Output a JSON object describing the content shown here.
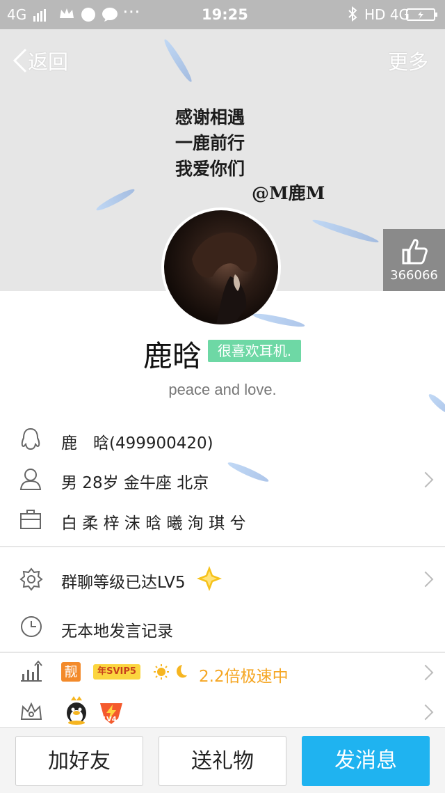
{
  "status_bar": {
    "network": "4G",
    "time": "19:25",
    "right": "HD 4G"
  },
  "nav": {
    "back_label": "返回",
    "more_label": "更多"
  },
  "cover": {
    "lines": [
      "感谢相遇",
      "一鹿前行",
      "我爱你们"
    ],
    "handle": "@M鹿M"
  },
  "like": {
    "count": "366066"
  },
  "profile": {
    "nickname": "鹿晗",
    "tag": "很喜欢耳机.",
    "signature": "peace and love."
  },
  "info": {
    "qq_line": "鹿　晗(499900420)",
    "personal_line": "男  28岁  金牛座  北京",
    "company_line": "白 柔 梓 沫 晗 曦 洵 琪 兮",
    "group_level": "群聊等级已达LV5",
    "history": "无本地发言记录",
    "vip_badge": "靓",
    "svip_badge": "年SVIP5",
    "speed": "2.2倍极速中",
    "lv_badge": "LV4"
  },
  "colors": {
    "accent": "#1fb3f0",
    "tag": "#6ed8a5",
    "speed": "#f5a623"
  },
  "buttons": {
    "add_friend": "加好友",
    "send_gift": "送礼物",
    "send_message": "发消息"
  }
}
